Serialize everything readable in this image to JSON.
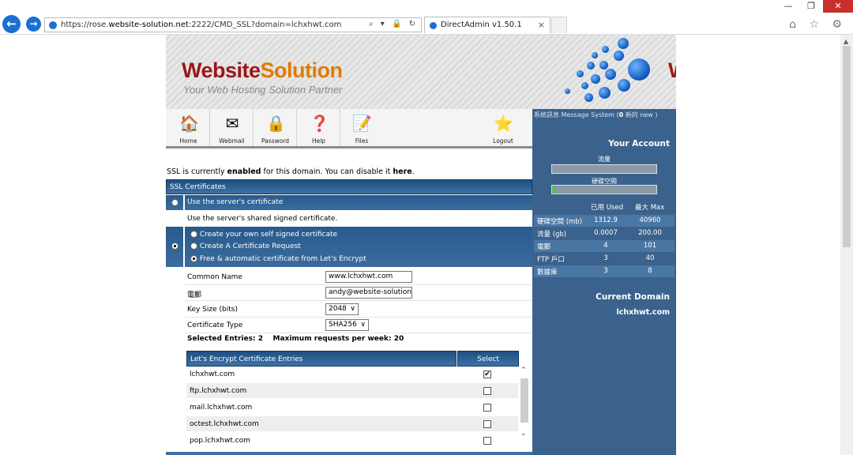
{
  "browser": {
    "url_prefix": "https://rose.",
    "url_domain": "website-solution.net",
    "url_suffix": ":2222/CMD_SSL?domain=lchxhwt.com",
    "url_tools": "⌕ ▾ 🔒 ↻",
    "tab_title": "DirectAdmin v1.50.1",
    "tab_close": "×",
    "back": "←",
    "forward": "→",
    "minimize": "—",
    "restore": "❐",
    "close": "✕",
    "right_icons": "⌂ ☆ ⚙"
  },
  "banner": {
    "logo_part1": "Website",
    "logo_part2": "Solution",
    "tagline": "Your Web Hosting Solution Partner",
    "logo_repeat": "W"
  },
  "nav": [
    {
      "label": "Home",
      "icon": "house-icon",
      "glyph": "🏠"
    },
    {
      "label": "Webmail",
      "icon": "envelope-icon",
      "glyph": "✉"
    },
    {
      "label": "Password",
      "icon": "padlock-icon",
      "glyph": "🔒"
    },
    {
      "label": "Help",
      "icon": "question-icon",
      "glyph": "❓"
    },
    {
      "label": "Files",
      "icon": "files-icon",
      "glyph": "📝"
    },
    {
      "label": "Logout",
      "icon": "star-icon",
      "glyph": "⭐"
    }
  ],
  "sidebar": {
    "msg_prefix": "系統訊息 Message System (",
    "msg_count": "0",
    "msg_suffix": " 新的 new )",
    "account_heading": "Your Account",
    "bandwidth_label": "流量",
    "disk_label": "硬碟空間",
    "bandwidth_fraction": 0.0,
    "disk_fraction": 0.032,
    "col_used": "已用 Used",
    "col_max": "最大 Max",
    "stats": [
      {
        "name": "硬碟空間 (mb)",
        "used": "1312.9",
        "max": "40960"
      },
      {
        "name": "流量 (gb)",
        "used": "0.0007",
        "max": "200.00"
      },
      {
        "name": "電郵",
        "used": "4",
        "max": "101"
      },
      {
        "name": "FTP 戶口",
        "used": "3",
        "max": "40"
      },
      {
        "name": "數據庫",
        "used": "3",
        "max": "8"
      }
    ],
    "domain_heading": "Current Domain",
    "domain": "lchxhwt.com"
  },
  "ssl": {
    "intro_a": "SSL is currently ",
    "intro_b": "enabled",
    "intro_c": " for this domain. You can disable it ",
    "intro_d": "here",
    "intro_e": ".",
    "section_title": "SSL Certificates",
    "opt_server": "Use the server's certificate",
    "opt_server_desc": "Use the server's shared signed certificate.",
    "opt_self": "Create your own self signed certificate",
    "opt_request": "Create A Certificate Request",
    "opt_letsencrypt": "Free & automatic certificate from Let's Encrypt"
  },
  "form": {
    "common_name_label": "Common Name",
    "common_name_value": "www.lchxhwt.com",
    "email_label": "電郵",
    "email_value": "andy@website-solution",
    "keysize_label": "Key Size (bits)",
    "keysize_value": "2048",
    "certtype_label": "Certificate Type",
    "certtype_value": "SHA256"
  },
  "entries": {
    "selected_label": "Selected Entries:",
    "selected_count": "2",
    "max_label": "Maximum requests per week:",
    "max_count": "20",
    "col_entries": "Let's Encrypt Certificate Entries",
    "col_select": "Select",
    "rows": [
      {
        "domain": "lchxhwt.com",
        "checked": "✔"
      },
      {
        "domain": "ftp.lchxhwt.com",
        "checked": ""
      },
      {
        "domain": "mail.lchxhwt.com",
        "checked": ""
      },
      {
        "domain": "octest.lchxhwt.com",
        "checked": ""
      },
      {
        "domain": "pop.lchxhwt.com",
        "checked": ""
      }
    ]
  }
}
